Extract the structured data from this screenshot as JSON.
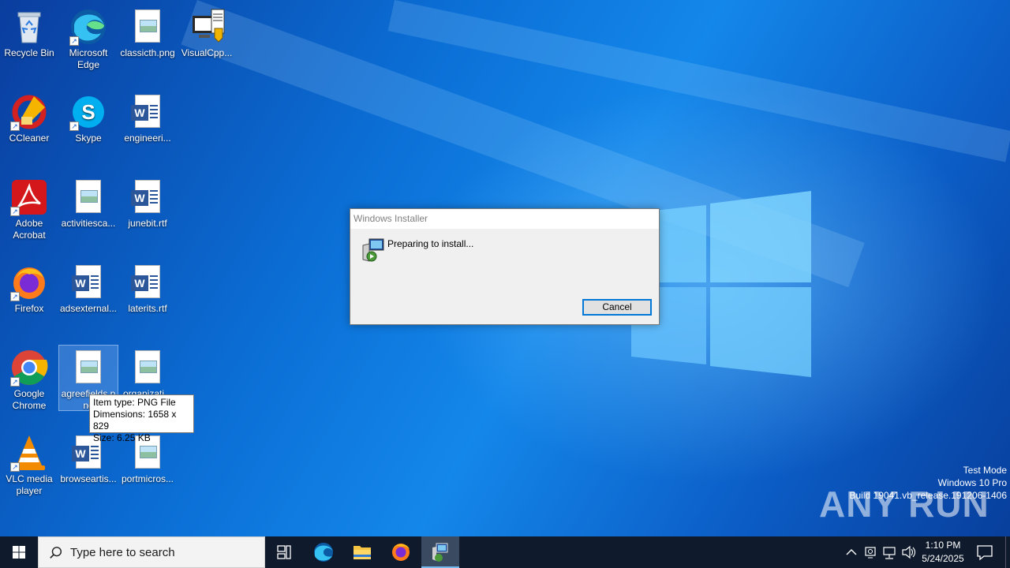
{
  "desktop": {
    "icons": [
      {
        "label": "Recycle Bin"
      },
      {
        "label": "Microsoft Edge"
      },
      {
        "label": "classicth.png"
      },
      {
        "label": "VisualCpp..."
      },
      {
        "label": "CCleaner"
      },
      {
        "label": "Skype"
      },
      {
        "label": "engineeri..."
      },
      {
        "label": "Adobe Acrobat"
      },
      {
        "label": "activitiesca..."
      },
      {
        "label": "junebit.rtf"
      },
      {
        "label": "Firefox"
      },
      {
        "label": "adsexternal..."
      },
      {
        "label": "laterits.rtf"
      },
      {
        "label": "Google Chrome"
      },
      {
        "label": "agreefields.png"
      },
      {
        "label": "organizati..."
      },
      {
        "label": "VLC media player"
      },
      {
        "label": "browseartis..."
      },
      {
        "label": "portmicros..."
      }
    ],
    "tooltip": {
      "line1": "Item type: PNG File",
      "line2": "Dimensions: 1658 x 829",
      "line3": "Size: 6.25 KB"
    }
  },
  "dialog": {
    "title": "Windows Installer",
    "message": "Preparing to install...",
    "cancel_label": "Cancel"
  },
  "watermark": {
    "brand": "ANY RUN",
    "line1": "Test Mode",
    "line2": "Windows 10 Pro",
    "line3": "Build 19041.vb_release.191206-1406"
  },
  "taskbar": {
    "search_placeholder": "Type here to search",
    "time": "1:10 PM",
    "date": "5/24/2025"
  },
  "colors": {
    "accent": "#0078d7",
    "taskbar": "#0f1b2c"
  }
}
